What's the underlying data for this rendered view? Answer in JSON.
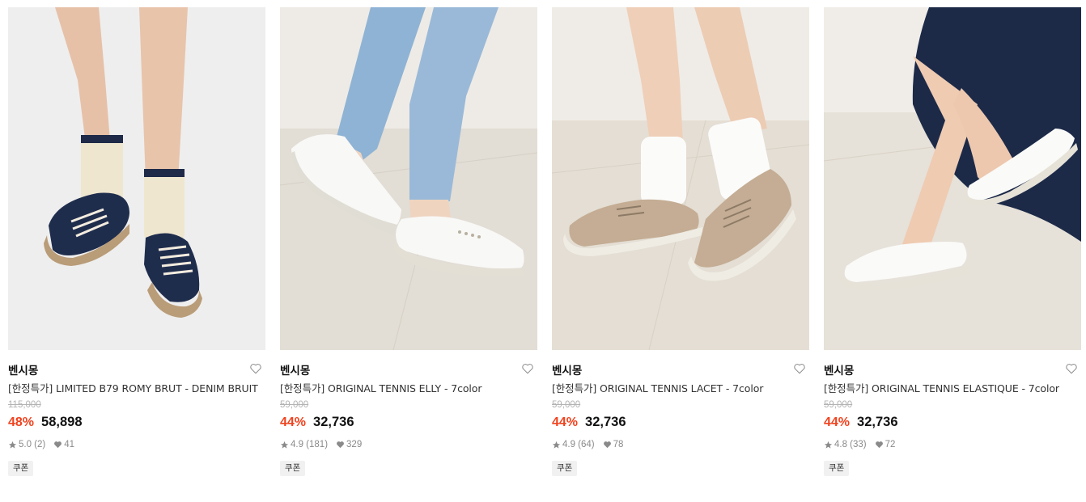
{
  "products": [
    {
      "brand": "벤시몽",
      "name": "[한정특가] LIMITED B79 ROMY BRUT - DENIM BRUIT",
      "original_price": "115,000",
      "discount": "48%",
      "price": "58,898",
      "rating": "5.0 (2)",
      "likes": "41",
      "coupon": "쿠폰",
      "image": "denim-sneakers-with-socks-photo"
    },
    {
      "brand": "벤시몽",
      "name": "[한정특가] ORIGINAL TENNIS ELLY - 7color",
      "original_price": "59,000",
      "discount": "44%",
      "price": "32,736",
      "rating": "4.9 (181)",
      "likes": "329",
      "coupon": "쿠폰",
      "image": "white-slip-on-sneakers-jeans-photo"
    },
    {
      "brand": "벤시몽",
      "name": "[한정특가] ORIGINAL TENNIS LACET - 7color",
      "original_price": "59,000",
      "discount": "44%",
      "price": "32,736",
      "rating": "4.9 (64)",
      "likes": "78",
      "coupon": "쿠폰",
      "image": "beige-lace-up-sneakers-white-socks-photo"
    },
    {
      "brand": "벤시몽",
      "name": "[한정특가] ORIGINAL TENNIS ELASTIQUE - 7color",
      "original_price": "59,000",
      "discount": "44%",
      "price": "32,736",
      "rating": "4.8 (33)",
      "likes": "72",
      "coupon": "쿠폰",
      "image": "white-elastic-slip-on-navy-skirt-photo"
    }
  ],
  "colors": {
    "discount": "#f0421e",
    "strike": "#b3b3b3",
    "meta": "#8a8a8a",
    "coupon_bg": "#f1f1f1"
  },
  "icons": {
    "like": "heart-outline-icon",
    "rating": "star-icon",
    "likes_count": "heart-filled-icon"
  }
}
